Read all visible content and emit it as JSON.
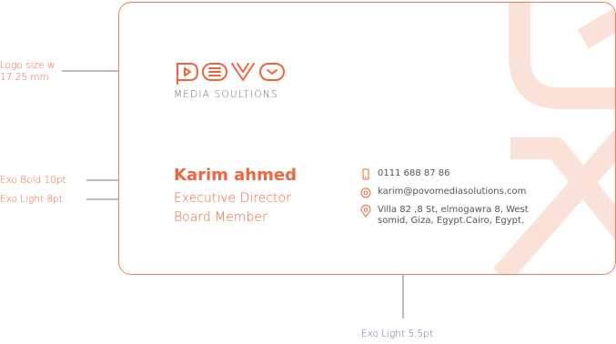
{
  "annotations": {
    "logo_size_line1": "Logo size w",
    "logo_size_line2": "17.25 mm",
    "bold": "Exo Bold 10pt",
    "light": "Exo Light 8pt",
    "small": "Exo Light 5.5pt"
  },
  "card": {
    "logo_wordmark": "povo",
    "logo_subtitle": "MEDIA SOULTIONS",
    "name": "Karim ahmed",
    "title_line1": "Executive Director",
    "title_line2": "Board Member",
    "phone": "0111 688 87 86",
    "email": "karim@povomediasolutions.com",
    "address_line1": "Villa 82 ,8 St, elmogawra 8, West",
    "address_line2": "somid, Giza, Egypt.Cairo, Egypt.",
    "icons": [
      "phone-icon",
      "at-icon",
      "location-pin-icon"
    ]
  },
  "colors": {
    "accent": "#f0643c",
    "bottom_annotation": "#7a5aa0",
    "arrow": "#7a7a7a"
  }
}
